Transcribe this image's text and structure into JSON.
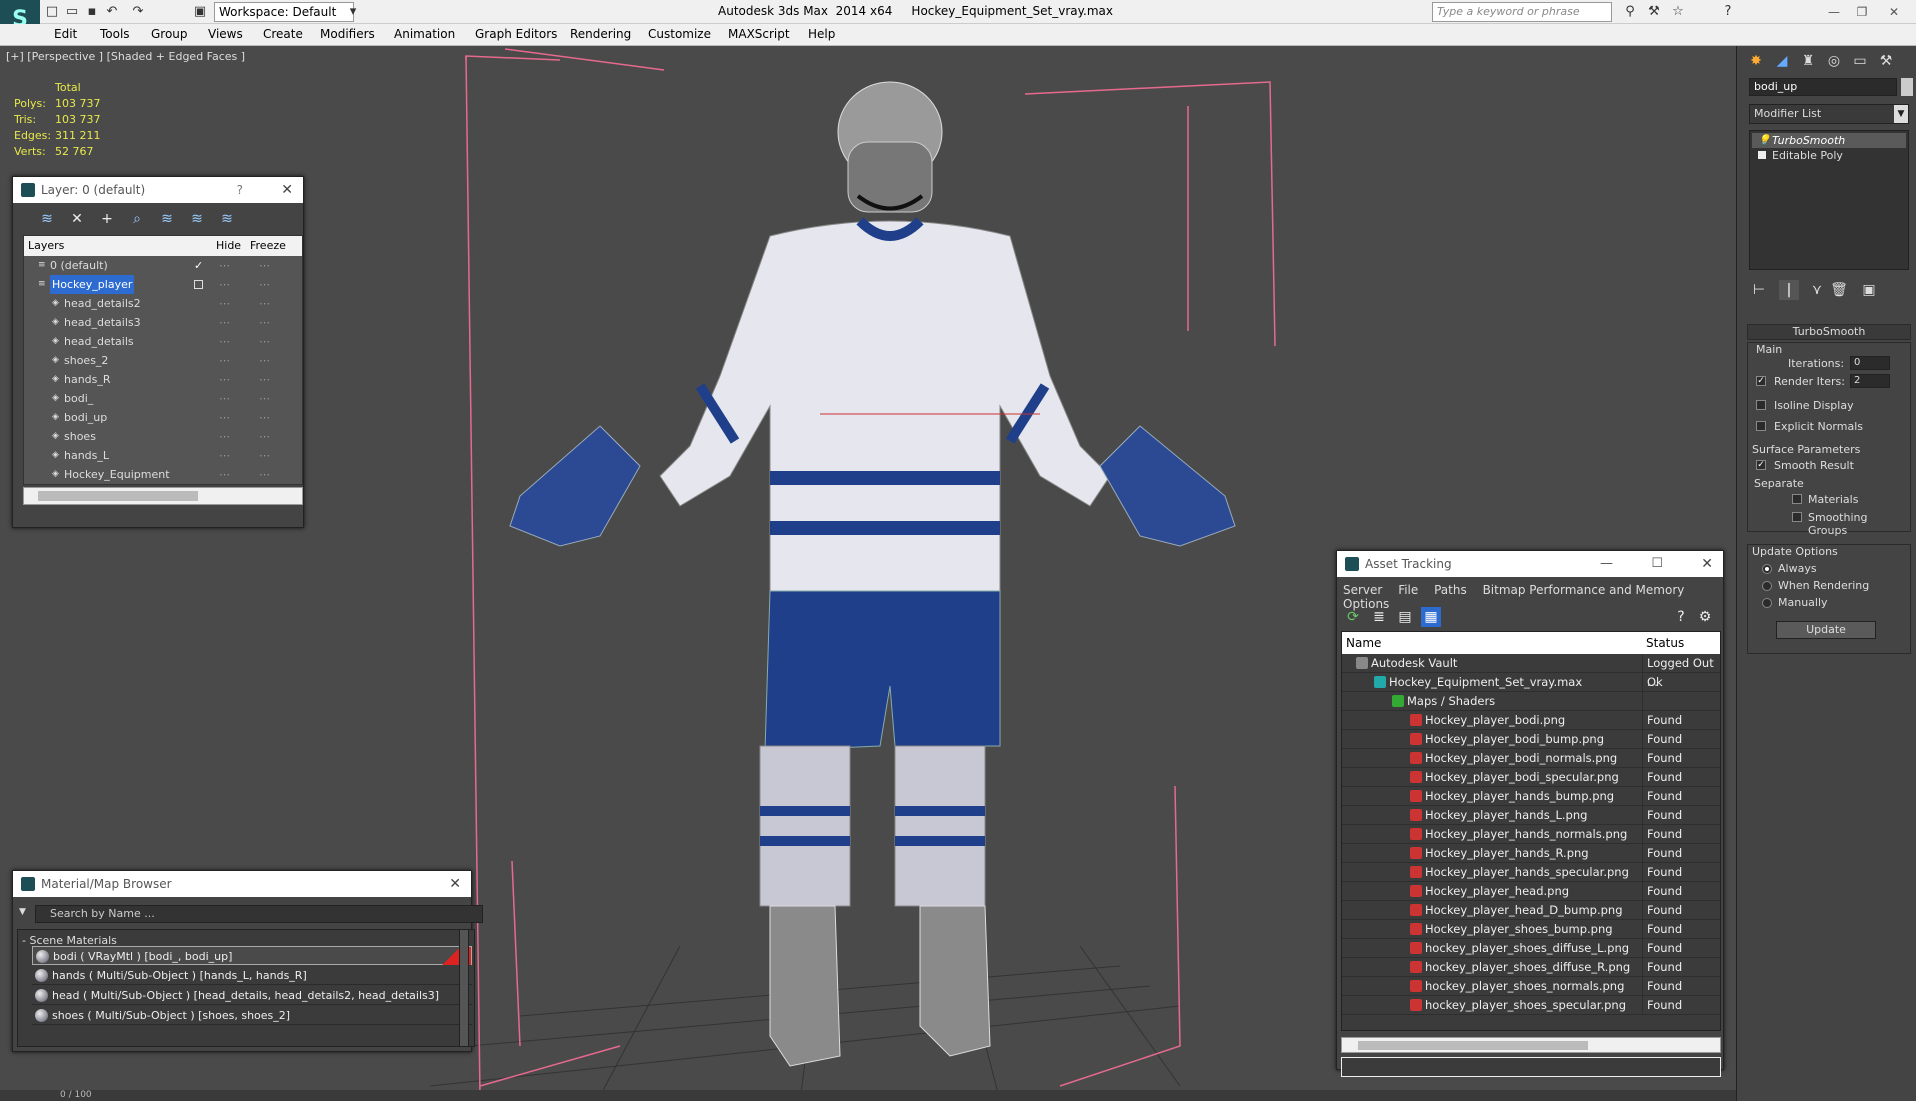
{
  "app": {
    "title": "Autodesk 3ds Max  2014 x64     Hockey_Equipment_Set_vray.max",
    "workspace": "Workspace: Default",
    "search_placeholder": "Type a keyword or phrase"
  },
  "menu": [
    "Edit",
    "Tools",
    "Group",
    "Views",
    "Create",
    "Modifiers",
    "Animation",
    "Graph Editors",
    "Rendering",
    "Customize",
    "MAXScript",
    "Help"
  ],
  "viewport": {
    "label": "[+] [Perspective ] [Shaded + Edged Faces ]",
    "stats": {
      "header": "Total",
      "rows": [
        {
          "k": "Polys:",
          "v": "103 737"
        },
        {
          "k": "Tris:",
          "v": "103 737"
        },
        {
          "k": "Edges:",
          "v": "311 211"
        },
        {
          "k": "Verts:",
          "v": "52 767"
        }
      ]
    }
  },
  "layer_panel": {
    "title": "Layer: 0 (default)",
    "col_layers": "Layers",
    "col_hide": "Hide",
    "col_freeze": "Freeze",
    "rows": [
      {
        "name": "0 (default)",
        "indent": 1,
        "selected": false
      },
      {
        "name": "Hockey_player",
        "indent": 1,
        "selected": true
      },
      {
        "name": "head_details2",
        "indent": 2,
        "selected": false
      },
      {
        "name": "head_details3",
        "indent": 2,
        "selected": false
      },
      {
        "name": "head_details",
        "indent": 2,
        "selected": false
      },
      {
        "name": "shoes_2",
        "indent": 2,
        "selected": false
      },
      {
        "name": "hands_R",
        "indent": 2,
        "selected": false
      },
      {
        "name": "bodi_",
        "indent": 2,
        "selected": false
      },
      {
        "name": "bodi_up",
        "indent": 2,
        "selected": false
      },
      {
        "name": "shoes",
        "indent": 2,
        "selected": false
      },
      {
        "name": "hands_L",
        "indent": 2,
        "selected": false
      },
      {
        "name": "Hockey_Equipment",
        "indent": 2,
        "selected": false
      }
    ]
  },
  "material_browser": {
    "title": "Material/Map Browser",
    "search_placeholder": "Search by Name ...",
    "section": "- Scene Materials",
    "rows": [
      "bodi  ( VRayMtl ) [bodi_, bodi_up]",
      "hands  ( Multi/Sub-Object ) [hands_L, hands_R]",
      "head  ( Multi/Sub-Object ) [head_details, head_details2, head_details3]",
      "shoes  ( Multi/Sub-Object ) [shoes, shoes_2]"
    ]
  },
  "asset_tracking": {
    "title": "Asset Tracking",
    "menu": [
      "Server",
      "File",
      "Paths",
      "Bitmap Performance and Memory",
      "Options"
    ],
    "col_name": "Name",
    "col_status": "Status",
    "rows": [
      {
        "name": "Autodesk Vault",
        "status": "Logged Out ...",
        "indent": 1
      },
      {
        "name": "Hockey_Equipment_Set_vray.max",
        "status": "Ok",
        "indent": 2
      },
      {
        "name": "Maps / Shaders",
        "status": "",
        "indent": 3
      },
      {
        "name": "Hockey_player_bodi.png",
        "status": "Found",
        "indent": 4
      },
      {
        "name": "Hockey_player_bodi_bump.png",
        "status": "Found",
        "indent": 4
      },
      {
        "name": "Hockey_player_bodi_normals.png",
        "status": "Found",
        "indent": 4
      },
      {
        "name": "Hockey_player_bodi_specular.png",
        "status": "Found",
        "indent": 4
      },
      {
        "name": "Hockey_player_hands_bump.png",
        "status": "Found",
        "indent": 4
      },
      {
        "name": "Hockey_player_hands_L.png",
        "status": "Found",
        "indent": 4
      },
      {
        "name": "Hockey_player_hands_normals.png",
        "status": "Found",
        "indent": 4
      },
      {
        "name": "Hockey_player_hands_R.png",
        "status": "Found",
        "indent": 4
      },
      {
        "name": "Hockey_player_hands_specular.png",
        "status": "Found",
        "indent": 4
      },
      {
        "name": "Hockey_player_head.png",
        "status": "Found",
        "indent": 4
      },
      {
        "name": "Hockey_player_head_D_bump.png",
        "status": "Found",
        "indent": 4
      },
      {
        "name": "Hockey_player_shoes_bump.png",
        "status": "Found",
        "indent": 4
      },
      {
        "name": "hockey_player_shoes_diffuse_L.png",
        "status": "Found",
        "indent": 4
      },
      {
        "name": "hockey_player_shoes_diffuse_R.png",
        "status": "Found",
        "indent": 4
      },
      {
        "name": "hockey_player_shoes_normals.png",
        "status": "Found",
        "indent": 4
      },
      {
        "name": "hockey_player_shoes_specular.png",
        "status": "Found",
        "indent": 4
      }
    ]
  },
  "command_panel": {
    "object_name": "bodi_up",
    "modifier_list": "Modifier List",
    "stack": [
      "TurboSmooth",
      "Editable Poly"
    ],
    "turbosmooth": {
      "title": "TurboSmooth",
      "main": "Main",
      "iterations_label": "Iterations:",
      "iterations": "0",
      "render_iters_label": "Render Iters:",
      "render_iters": "2",
      "isoline": "Isoline Display",
      "explicit": "Explicit Normals",
      "surface": "Surface Parameters",
      "smooth_result": "Smooth Result",
      "separate": "Separate",
      "materials": "Materials",
      "smoothing_groups": "Smoothing Groups",
      "update_options": "Update Options",
      "always": "Always",
      "when_rendering": "When Rendering",
      "manually": "Manually",
      "update": "Update"
    }
  },
  "status_bar": "0 / 100",
  "colors": {
    "jersey_blue": "#1f3f8a",
    "jersey_white": "#e6e6ee",
    "selection_blue": "#2d6bd1",
    "bbox_pink": "#e66a8e"
  }
}
